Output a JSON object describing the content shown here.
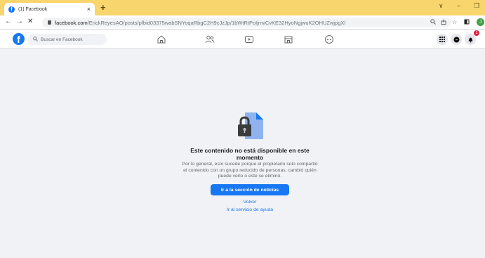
{
  "browser": {
    "tab_title": "(1) Facebook",
    "tab_close": "×",
    "new_tab": "+",
    "url_host": "facebook.com",
    "url_path": "/ErickReyesAO/posts/pfbid03375wabSNYoqaRbgC2H9cJzJp/1bWtRtPoIjmvCvKE32HyoNgjwuK2OHUZwjpgXl",
    "nav_back": "←",
    "nav_forward": "→",
    "nav_reload": "✕",
    "profile_initial": "J",
    "win_min": "–",
    "win_chevron": "∨",
    "win_restore": "❐"
  },
  "facebook": {
    "logo": "f",
    "search_placeholder": "Buscar en Facebook",
    "notification_count": "1"
  },
  "main": {
    "title": "Este contenido no está disponible en este momento",
    "description": "Por lo general, esto sucede porque el propietario solo compartió el contenido con un grupo reducido de personas, cambió quién puede verlo o este se eliminó.",
    "cta_label": "Ir a la sección de noticias",
    "back_link": "Volver",
    "help_link": "Ir al servicio de ayuda"
  },
  "colors": {
    "tab_strip": "#f9d56e",
    "fb_blue": "#1877f2",
    "background": "#f0f2f5"
  }
}
